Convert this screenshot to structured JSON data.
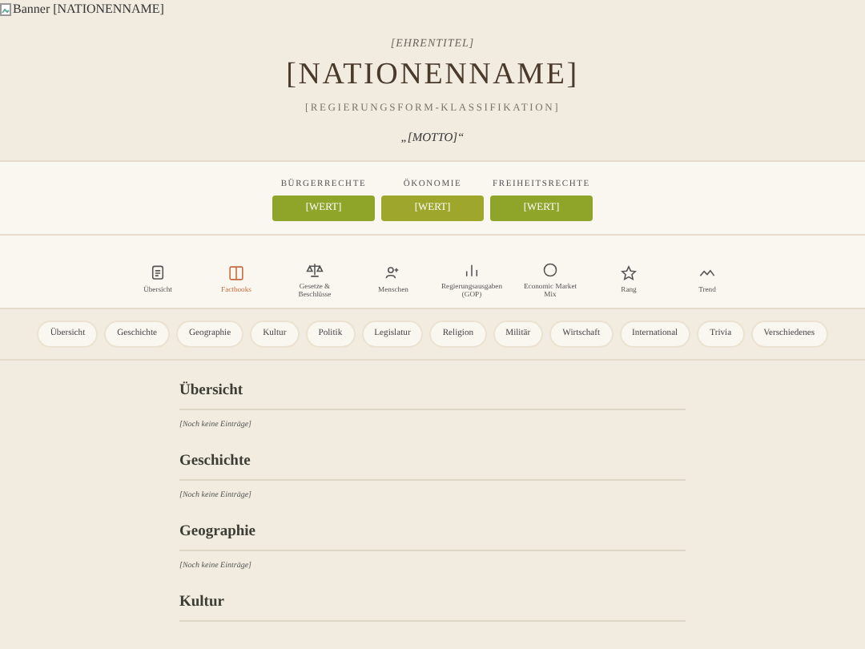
{
  "banner": {
    "alt_text": "Banner [NATIONENNAME]"
  },
  "header": {
    "honorific": "[EHRENTITEL]",
    "name": "[NATIONENNAME]",
    "government": "[REGIERUNGSFORM-KLASSIFIKATION]",
    "motto": "„[MOTTO]“"
  },
  "stats": [
    {
      "label": "BÜRGERRECHTE",
      "value": "[WERT]",
      "color": "#8ea52a"
    },
    {
      "label": "ÖKONOMIE",
      "value": "[WERT]",
      "color": "#9ea62b"
    },
    {
      "label": "FREIHEITSRECHTE",
      "value": "[WERT]",
      "color": "#8ea52a"
    }
  ],
  "nav": [
    {
      "label": "Übersicht",
      "kind": "document",
      "selected": false
    },
    {
      "label": "Factbooks",
      "kind": "book",
      "selected": true
    },
    {
      "label": "Gesetze & Beschlüsse",
      "kind": "scales",
      "selected": false
    },
    {
      "label": "Menschen",
      "kind": "people",
      "selected": false
    },
    {
      "label": "Regierungsausgaben (GOP)",
      "kind": "bars",
      "selected": false
    },
    {
      "label": "Economic Market Mix",
      "kind": "circle",
      "selected": false
    },
    {
      "label": "Rang",
      "kind": "star",
      "selected": false
    },
    {
      "label": "Trend",
      "kind": "trend",
      "selected": false
    }
  ],
  "pills": [
    "Übersicht",
    "Geschichte",
    "Geographie",
    "Kultur",
    "Politik",
    "Legislatur",
    "Religion",
    "Militär",
    "Wirtschaft",
    "International",
    "Trivia",
    "Verschiedenes"
  ],
  "sections": [
    {
      "title": "Übersicht",
      "note": "[Noch keine Einträge]"
    },
    {
      "title": "Geschichte",
      "note": "[Noch keine Einträge]"
    },
    {
      "title": "Geographie",
      "note": "[Noch keine Einträge]"
    },
    {
      "title": "Kultur"
    }
  ]
}
